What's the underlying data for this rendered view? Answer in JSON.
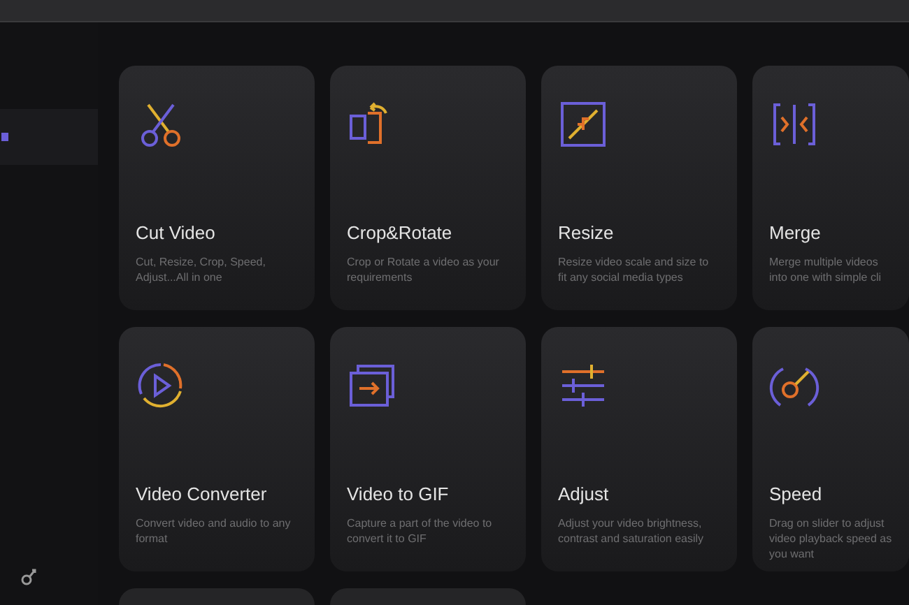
{
  "sidebar": {
    "items": [
      {
        "selected": true
      }
    ]
  },
  "cards": [
    {
      "kind": "tool",
      "title": "Cut Video",
      "description": "Cut, Resize, Crop, Speed, Adjust...All in one"
    },
    {
      "kind": "tool",
      "title": "Crop&Rotate",
      "description": "Crop or Rotate a video as your requirements"
    },
    {
      "kind": "tool",
      "title": "Resize",
      "description": "Resize video scale and size to fit any social media types"
    },
    {
      "kind": "tool",
      "title": "Merge",
      "description": "Merge multiple videos into one with simple cli"
    },
    {
      "kind": "tool",
      "title": "Video Converter",
      "description": "Convert video and audio to any format"
    },
    {
      "kind": "tool",
      "title": "Video to GIF",
      "description": "Capture a part of the video to convert it to GIF"
    },
    {
      "kind": "tool",
      "title": "Adjust",
      "description": "Adjust your video brightness, contrast and saturation easily"
    },
    {
      "kind": "tool",
      "title": "Speed",
      "description": "Drag on slider to adjust video playback speed as you want"
    },
    {
      "kind": "blank"
    },
    {
      "kind": "blank"
    }
  ]
}
